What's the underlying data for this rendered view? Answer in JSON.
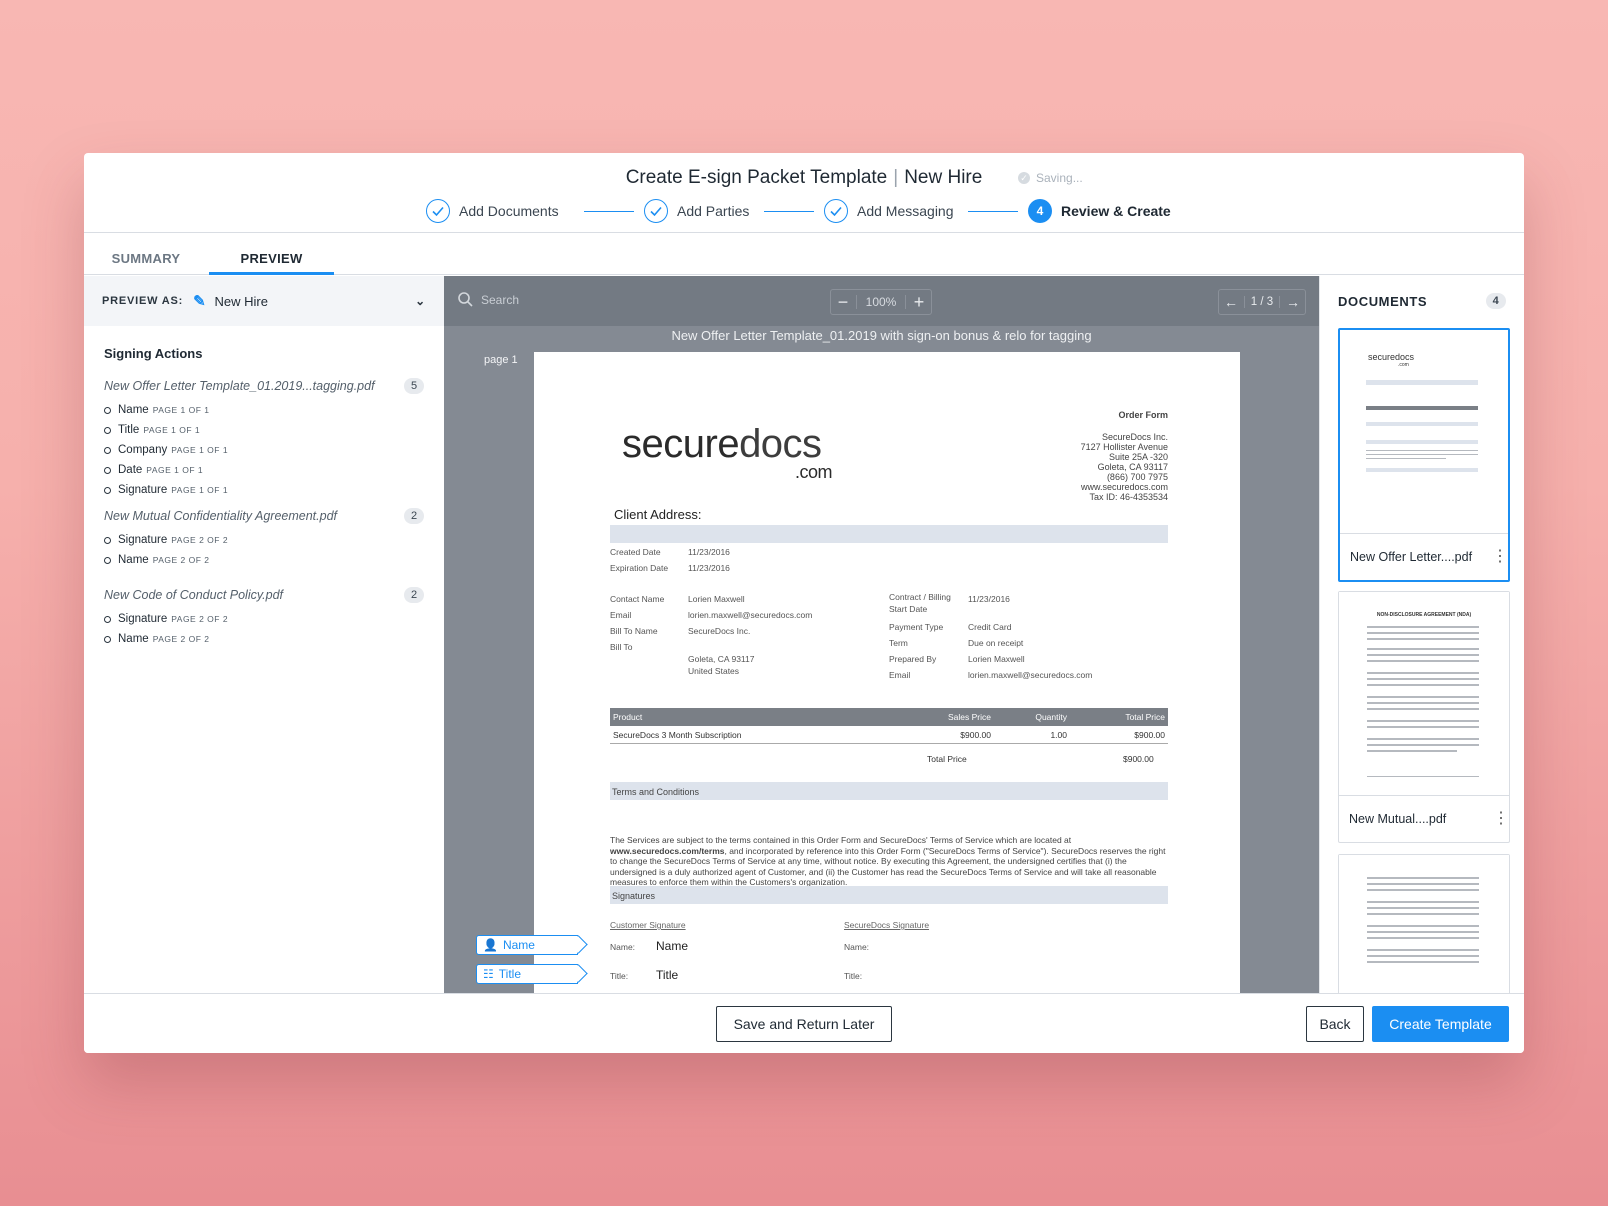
{
  "header": {
    "title": "Create E-sign Packet Template",
    "subtitle": "New Hire",
    "saving": "Saving...",
    "steps": [
      {
        "label": "Add Documents",
        "state": "done"
      },
      {
        "label": "Add Parties",
        "state": "done"
      },
      {
        "label": "Add Messaging",
        "state": "done"
      },
      {
        "label": "Review & Create",
        "state": "active",
        "number": "4"
      }
    ]
  },
  "tabs": [
    "SUMMARY",
    "PREVIEW"
  ],
  "preview_as": {
    "label": "PREVIEW AS:",
    "value": "New Hire"
  },
  "signing": {
    "title": "Signing Actions",
    "groups": [
      {
        "file": "New Offer Letter Template_01.2019...tagging.pdf",
        "count": "5",
        "actions": [
          {
            "name": "Name",
            "page": "PAGE 1 OF 1"
          },
          {
            "name": "Title",
            "page": "PAGE 1 OF 1"
          },
          {
            "name": "Company",
            "page": "PAGE 1 OF 1"
          },
          {
            "name": "Date",
            "page": "PAGE 1 OF 1"
          },
          {
            "name": "Signature",
            "page": "PAGE 1 OF 1"
          }
        ]
      },
      {
        "file": "New Mutual Confidentiality Agreement.pdf",
        "count": "2",
        "actions": [
          {
            "name": "Signature",
            "page": "PAGE 2 OF 2"
          },
          {
            "name": "Name",
            "page": "PAGE 2 OF 2"
          }
        ]
      },
      {
        "file": "New Code of Conduct Policy.pdf",
        "count": "2",
        "actions": [
          {
            "name": "Signature",
            "page": "PAGE 2 OF 2"
          },
          {
            "name": "Name",
            "page": "PAGE 2 OF 2"
          }
        ]
      }
    ]
  },
  "viewer": {
    "search_placeholder": "Search",
    "zoom": "100%",
    "pager": "1 / 3",
    "doc_title": "New Offer Letter Template_01.2019 with sign-on bonus & relo for tagging",
    "page_label": "page 1"
  },
  "paper": {
    "logo_main": "secure",
    "logo_bold": "docs",
    "logo_com": ".com",
    "order_form": "Order Form",
    "company_lines": [
      "SecureDocs Inc.",
      "7127 Hollister Avenue",
      "Suite 25A -320",
      "Goleta, CA 93117",
      "(866) 700 7975",
      "www.securedocs.com",
      "Tax ID: 46-4353534"
    ],
    "client_address": "Client Address:",
    "created_label": "Created Date",
    "created_value": "11/23/2016",
    "expiration_label": "Expiration Date",
    "expiration_value": "11/23/2016",
    "contact_label": "Contact Name",
    "contact_value": "Lorien Maxwell",
    "email_label": "Email",
    "email_value": "lorien.maxwell@securedocs.com",
    "billto_name_label": "Bill To Name",
    "billto_name_value": "SecureDocs Inc.",
    "billto_label": "Bill To",
    "billto_city": "Goleta, CA 93117",
    "billto_country": "United States",
    "contract_label": "Contract / Billing",
    "contract_label2": "Start Date",
    "contract_value": "11/23/2016",
    "payment_label": "Payment Type",
    "payment_value": "Credit Card",
    "term_label": "Term",
    "term_value": "Due on receipt",
    "prepared_label": "Prepared By",
    "prepared_value": "Lorien Maxwell",
    "email2_label": "Email",
    "email2_value": "lorien.maxwell@securedocs.com",
    "table_headers": [
      "Product",
      "Sales Price",
      "Quantity",
      "Total Price"
    ],
    "table_row": [
      "SecureDocs 3 Month Subscription",
      "$900.00",
      "1.00",
      "$900.00"
    ],
    "total_label": "Total Price",
    "total_value": "$900.00",
    "terms_heading": "Terms and Conditions",
    "terms_text_1": "The Services are subject to the terms contained in this Order Form and SecureDocs' Terms of Service which are located at",
    "terms_link": "www.securedocs.com/terms",
    "terms_text_2": ", and incorporated by reference into this Order Form (\"SecureDocs Terms of Service\"). SecureDocs reserves the right to change the SecureDocs Terms of Service at any time, without notice. By executing this Agreement, the undersigned certifies that (i) the undersigned is a duly authorized agent of Customer, and (ii) the Customer has read the SecureDocs Terms of Service and will take all reasonable measures to enforce them within the Customers's organization.",
    "signatures_heading": "Signatures",
    "customer_sig": "Customer Signature",
    "securedocs_sig": "SecureDocs Signature",
    "name_label": "Name:",
    "name_value": "Name",
    "title_label": "Title:",
    "title_value": "Title"
  },
  "tags": {
    "name": "Name",
    "title": "Title"
  },
  "documents": {
    "title": "DOCUMENTS",
    "count": "4",
    "items": [
      {
        "name": "New Offer Letter....pdf",
        "selected": true
      },
      {
        "name": "New Mutual....pdf",
        "selected": false,
        "thumb_heading": "NON-DISCLOSURE AGREEMENT (NDA)"
      },
      {
        "name": "",
        "selected": false
      }
    ],
    "thumb_logo": "securedocs",
    "thumb_logo_com": ".com"
  },
  "footer": {
    "save_later": "Save and Return Later",
    "back": "Back",
    "create": "Create Template"
  },
  "colors": {
    "accent": "#1b8ef2",
    "viewer_bg": "#848a93",
    "toolbar": "#737a83"
  }
}
